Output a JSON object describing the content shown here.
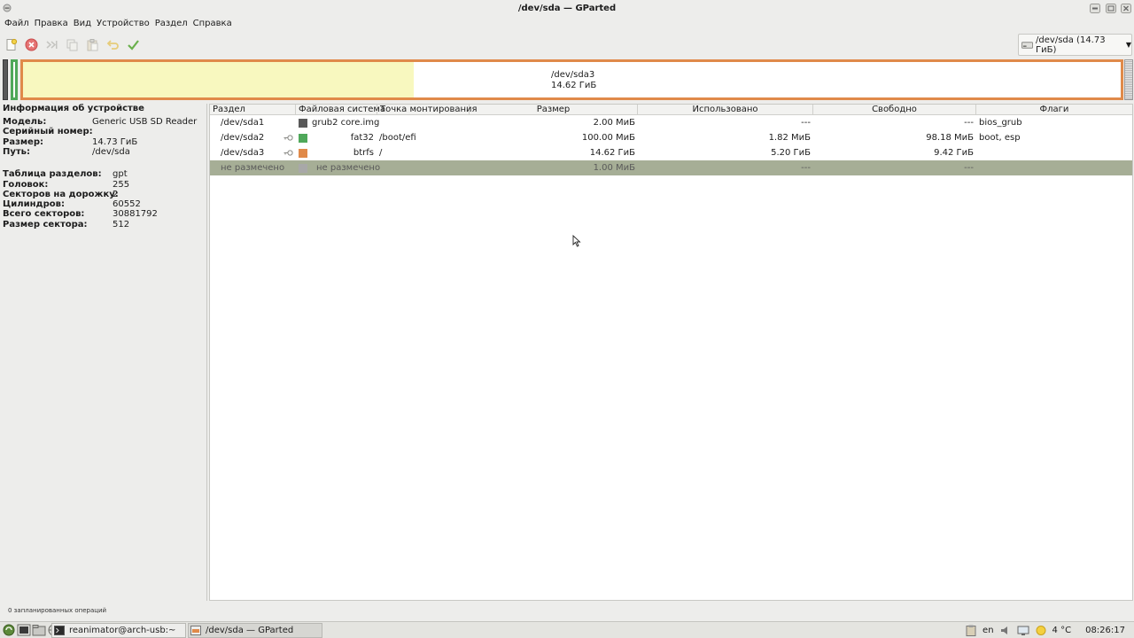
{
  "window": {
    "title": "/dev/sda — GParted"
  },
  "menu": [
    "Файл",
    "Правка",
    "Вид",
    "Устройство",
    "Раздел",
    "Справка"
  ],
  "toolbar": {
    "tools": [
      "new-icon",
      "delete-icon",
      "resize-icon",
      "copy-icon",
      "paste-icon",
      "undo-icon",
      "apply-icon"
    ]
  },
  "device_selector": {
    "value": "/dev/sda (14.73 ГиБ)"
  },
  "graph": {
    "label_name": "/dev/sda3",
    "label_size": "14.62 ГиБ"
  },
  "colors": {
    "grub": "#595959",
    "fat32": "#4fa85a",
    "btrfs": "#e08a4a",
    "unallocated": "#a8a8a8",
    "selection": "#a6ae96"
  },
  "device_info": {
    "header": "Информация об устройстве",
    "model_label": "Модель:",
    "model": "Generic USB SD Reader",
    "serial_label": "Серийный номер:",
    "serial": "",
    "size_label": "Размер:",
    "size": "14.73 ГиБ",
    "path_label": "Путь:",
    "path": "/dev/sda",
    "table_label": "Таблица разделов:",
    "table": "gpt",
    "heads_label": "Головок:",
    "heads": "255",
    "sectors_track_label": "Секторов на дорожку:",
    "sectors_track": "2",
    "cylinders_label": "Цилиндров:",
    "cylinders": "60552",
    "total_sectors_label": "Всего секторов:",
    "total_sectors": "30881792",
    "sector_size_label": "Размер сектора:",
    "sector_size": "512"
  },
  "table": {
    "headers": [
      "Раздел",
      "Файловая система",
      "Точка монтирования",
      "Размер",
      "Использовано",
      "Свободно",
      "Флаги"
    ],
    "rows": [
      {
        "partition": "/dev/sda1",
        "fs": "grub2 core.img",
        "mount": "",
        "size": "2.00 МиБ",
        "used": "---",
        "free": "---",
        "flags": "bios_grub"
      },
      {
        "partition": "/dev/sda2",
        "fs": "fat32",
        "mount": "/boot/efi",
        "size": "100.00 МиБ",
        "used": "1.82 МиБ",
        "free": "98.18 МиБ",
        "flags": "boot, esp"
      },
      {
        "partition": "/dev/sda3",
        "fs": "btrfs",
        "mount": "/",
        "size": "14.62 ГиБ",
        "used": "5.20 ГиБ",
        "free": "9.42 ГиБ",
        "flags": ""
      },
      {
        "partition": "не размечено",
        "fs": "не размечено",
        "mount": "",
        "size": "1.00 МиБ",
        "used": "---",
        "free": "---",
        "flags": ""
      }
    ]
  },
  "status": "0 запланированных операций",
  "taskbar": {
    "tasks": [
      "reanimator@arch-usb:~",
      "/dev/sda — GParted"
    ],
    "lang": "en",
    "weather": "4 °C",
    "clock": "08:26:17"
  }
}
